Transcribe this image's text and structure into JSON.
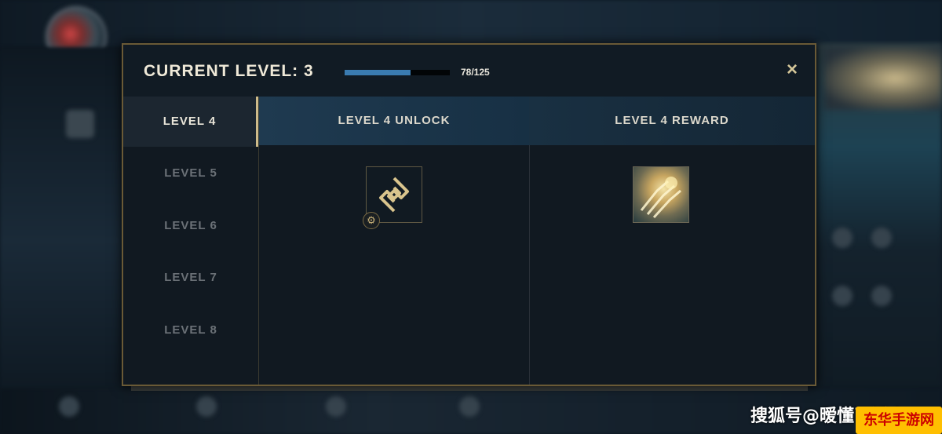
{
  "modal": {
    "title": "CURRENT LEVEL: 3",
    "progress_text": "78/125",
    "progress_fraction": 0.624,
    "close_label": "×"
  },
  "sidebar": {
    "items": [
      {
        "label": "LEVEL 4",
        "active": true
      },
      {
        "label": "LEVEL 5",
        "active": false
      },
      {
        "label": "LEVEL 6",
        "active": false
      },
      {
        "label": "LEVEL 7",
        "active": false
      },
      {
        "label": "LEVEL 8",
        "active": false
      }
    ]
  },
  "content": {
    "unlock_header": "LEVEL 4 UNLOCK",
    "reward_header": "LEVEL 4 REWARD",
    "unlock_icon": "rune-emblem-icon",
    "unlock_badge_icon": "gear-icon",
    "reward_icon": "champion-skin-icon"
  },
  "watermark": {
    "text": "搜狐号@暧懂了淫山",
    "logo_text": "东华手游网"
  },
  "colors": {
    "accent_gold": "#cdbb8a",
    "progress_blue": "#3a7bb0",
    "modal_border": "#6a5a36"
  }
}
